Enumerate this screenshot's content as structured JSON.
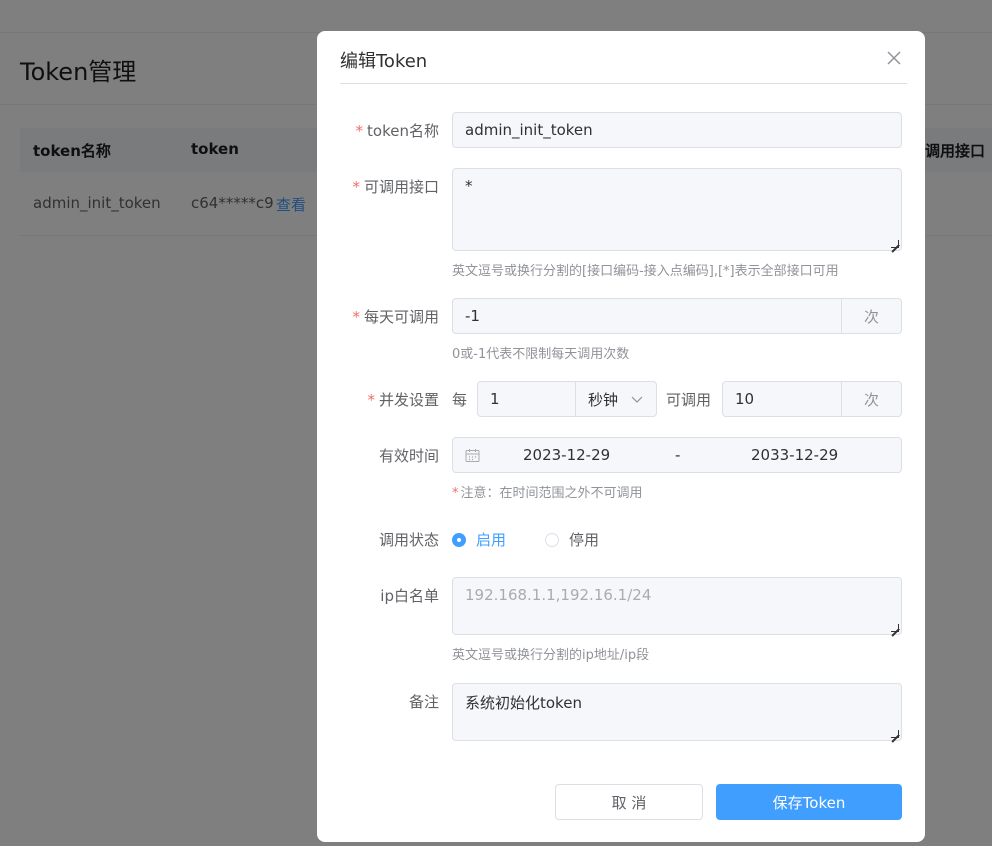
{
  "background": {
    "page_title": "Token管理",
    "table": {
      "headers": [
        "token名称",
        "token",
        "调用接口"
      ],
      "row": {
        "name": "admin_init_token",
        "token": "c64*****c9",
        "view_link": "查看"
      }
    }
  },
  "dialog": {
    "title": "编辑Token",
    "fields": {
      "token_name": {
        "label": "token名称",
        "value": "admin_init_token"
      },
      "interfaces": {
        "label": "可调用接口",
        "value": "*",
        "hint": "英文逗号或换行分割的[接口编码-接入点编码],[*]表示全部接口可用"
      },
      "daily": {
        "label": "每天可调用",
        "value": "-1",
        "unit": "次",
        "hint": "0或-1代表不限制每天调用次数"
      },
      "concurrency": {
        "label": "并发设置",
        "prefix": "每",
        "value": "1",
        "unit_select": "秒钟",
        "middle": "可调用",
        "limit": "10",
        "unit": "次"
      },
      "valid_time": {
        "label": "有效时间",
        "start": "2023-12-29",
        "separator": "-",
        "end": "2033-12-29",
        "hint": "注意：在时间范围之外不可调用"
      },
      "status": {
        "label": "调用状态",
        "options": [
          "启用",
          "停用"
        ],
        "selected": "启用"
      },
      "ip_whitelist": {
        "label": "ip白名单",
        "placeholder": "192.168.1.1,192.16.1/24",
        "hint": "英文逗号或换行分割的ip地址/ip段"
      },
      "remark": {
        "label": "备注",
        "value": "系统初始化token"
      }
    },
    "buttons": {
      "cancel": "取 消",
      "save": "保存Token"
    }
  },
  "colors": {
    "primary": "#409eff",
    "required": "#f56c6c",
    "overlay": "rgba(0,0,0,0.5)"
  }
}
